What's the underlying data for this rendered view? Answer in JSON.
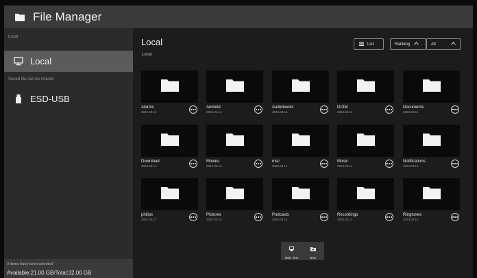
{
  "app": {
    "title": "File Manager"
  },
  "sidebar": {
    "local_section_label": "Local",
    "local_item_label": "Local",
    "saved_section_label": "Saved file can be moved",
    "usb_item_label": "ESD-USB",
    "selection_status": "0 items have been selected",
    "storage_status": "Available:21.00 GB/Total:32.00 GB"
  },
  "main": {
    "heading": "Local",
    "breadcrumb": "Local",
    "view_button_label": "List",
    "sort_label": "Ranking",
    "filter_label": "All"
  },
  "folders": [
    {
      "name": "Alarms",
      "date": "2024.03.14"
    },
    {
      "name": "Android",
      "date": "2024.03.14"
    },
    {
      "name": "Audiobooks",
      "date": "2024.03.14"
    },
    {
      "name": "DCIM",
      "date": "2024.03.14"
    },
    {
      "name": "Documents",
      "date": "2024.03.14"
    },
    {
      "name": "Download",
      "date": "2024.03.14"
    },
    {
      "name": "Movies",
      "date": "2024.03.14"
    },
    {
      "name": "msc",
      "date": "2024.03.17"
    },
    {
      "name": "Music",
      "date": "2024.03.14"
    },
    {
      "name": "Notifications",
      "date": "2024.03.14"
    },
    {
      "name": "philips",
      "date": "2024.03.17"
    },
    {
      "name": "Pictures",
      "date": "2024.03.14"
    },
    {
      "name": "Podcasts",
      "date": "2024.03.14"
    },
    {
      "name": "Recordings",
      "date": "2024.03.14"
    },
    {
      "name": "Ringtones",
      "date": "2024.03.14"
    }
  ],
  "actions": {
    "multiselect_label": "Mult...lect",
    "new_label": "New"
  }
}
